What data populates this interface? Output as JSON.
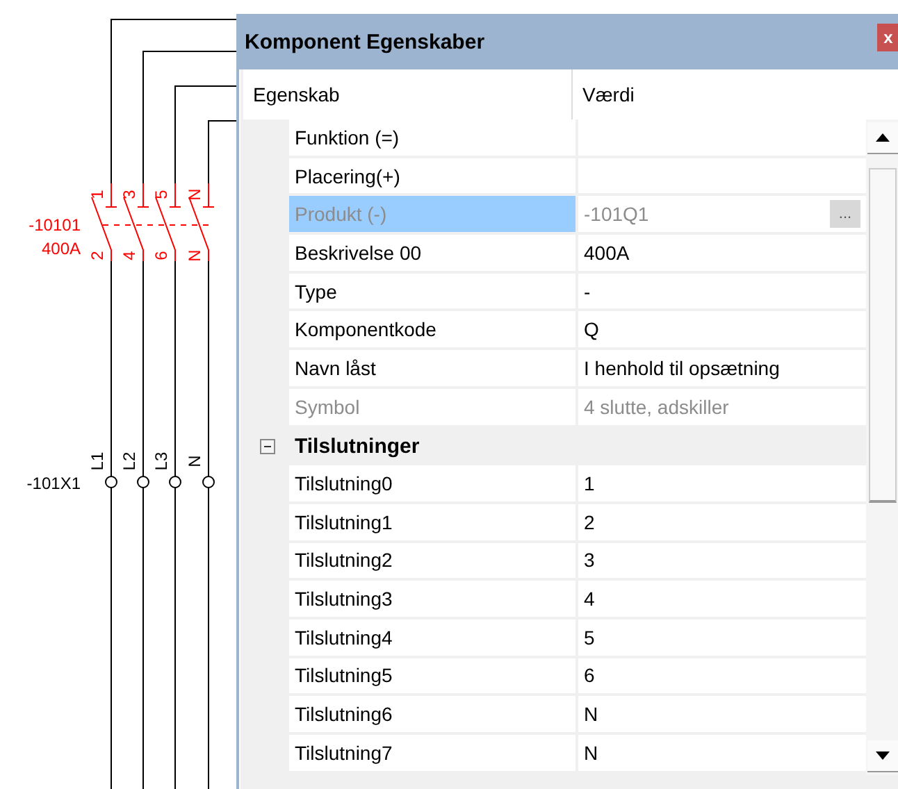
{
  "schematic": {
    "switch_labels": [
      "-10101",
      "400A"
    ],
    "top_terminals": [
      "1",
      "3",
      "5",
      "N"
    ],
    "bottom_terminals": [
      "2",
      "4",
      "6",
      "N"
    ],
    "connector_label": "-101X1",
    "connector_pins": [
      "L1",
      "L2",
      "L3",
      "N"
    ]
  },
  "window": {
    "title": "Komponent Egenskaber",
    "close": "x"
  },
  "grid": {
    "columns": [
      "Egenskab",
      "Værdi"
    ],
    "properties": [
      {
        "name": "Funktion (=)",
        "disabled": false,
        "selected": false
      },
      {
        "name": "Placering(+)",
        "disabled": false,
        "selected": false
      },
      {
        "name": "Produkt (-)",
        "value": "-101Q1",
        "disabled": true,
        "selected": true,
        "button": "..."
      },
      {
        "name": "Beskrivelse 00",
        "value": "400A",
        "disabled": false,
        "selected": false
      },
      {
        "name": "Type",
        "value": "-",
        "disabled": false,
        "selected": false
      },
      {
        "name": "Komponentkode",
        "value": "Q",
        "disabled": false,
        "selected": false
      },
      {
        "name": "Navn låst",
        "value": "I henhold til opsætning",
        "disabled": false,
        "selected": false
      },
      {
        "name": "Symbol",
        "value": "4 slutte, adskiller",
        "disabled": true,
        "selected": false
      }
    ],
    "categories": [
      {
        "name": "Tilslutninger",
        "expanded": true,
        "children": [
          {
            "name": "Tilslutning0",
            "value": "1",
            "disabled": false,
            "selected": false
          },
          {
            "name": "Tilslutning1",
            "value": "2",
            "disabled": false,
            "selected": false
          },
          {
            "name": "Tilslutning2",
            "value": "3",
            "disabled": false,
            "selected": false
          },
          {
            "name": "Tilslutning3",
            "value": "4",
            "disabled": false,
            "selected": false
          },
          {
            "name": "Tilslutning4",
            "value": "5",
            "disabled": false,
            "selected": false
          },
          {
            "name": "Tilslutning5",
            "value": "6",
            "disabled": false,
            "selected": false
          },
          {
            "name": "Tilslutning6",
            "value": "N",
            "disabled": false,
            "selected": false
          },
          {
            "name": "Tilslutning7",
            "value": "N",
            "disabled": false,
            "selected": false
          }
        ]
      }
    ]
  }
}
